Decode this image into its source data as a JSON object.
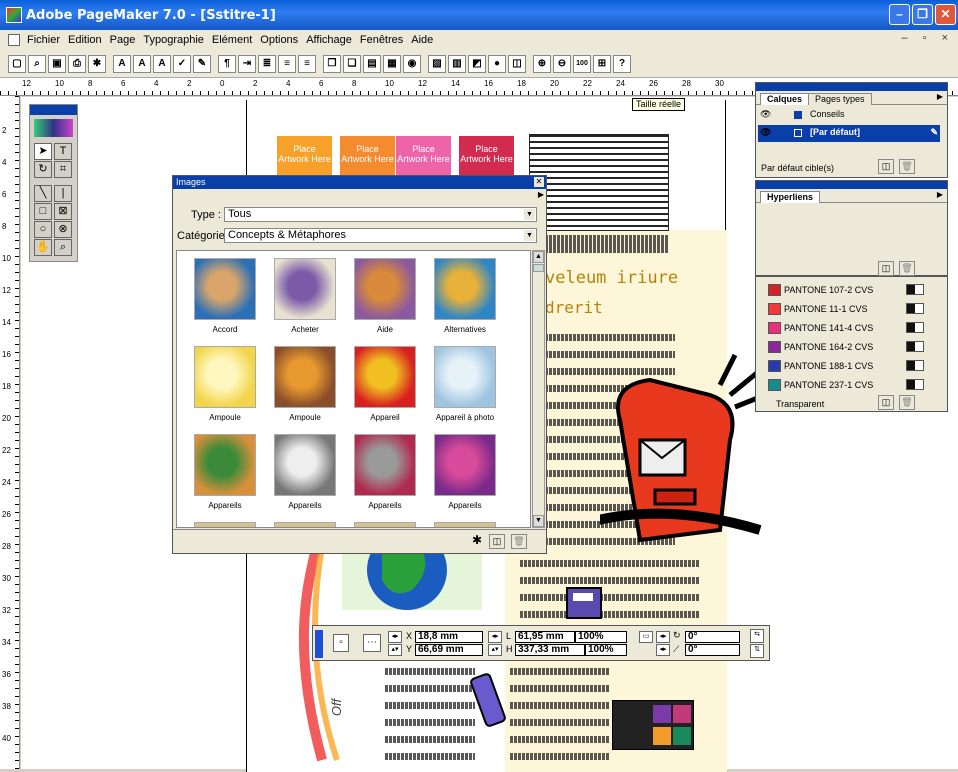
{
  "window": {
    "title": "Adobe PageMaker 7.0 - [Sstitre-1]",
    "min": "–",
    "max": "❐",
    "close": "✕"
  },
  "menu": [
    "Fichier",
    "Edition",
    "Page",
    "Typographie",
    "Elément",
    "Options",
    "Affichage",
    "Fenêtres",
    "Aide"
  ],
  "mdi": "– ▫ ×",
  "toolbar": [
    {
      "name": "new-icon",
      "g": "▢"
    },
    {
      "name": "open-icon",
      "g": "⌕"
    },
    {
      "name": "save-icon",
      "g": "▣"
    },
    {
      "name": "print-icon",
      "g": "⎙"
    },
    {
      "name": "find-icon",
      "g": "✱"
    },
    {
      "name": "font-size-icon",
      "g": "A"
    },
    {
      "name": "font-up-icon",
      "g": "A"
    },
    {
      "name": "font-down-icon",
      "g": "A"
    },
    {
      "name": "spell-icon",
      "g": "✓"
    },
    {
      "name": "edit-icon",
      "g": "✎"
    },
    {
      "name": "paragraph-icon",
      "g": "¶"
    },
    {
      "name": "indent-icon",
      "g": "⇥"
    },
    {
      "name": "bullets-icon",
      "g": "≣"
    },
    {
      "name": "left-align-icon",
      "g": "≡"
    },
    {
      "name": "right-align-icon",
      "g": "≡"
    },
    {
      "name": "copy-icon",
      "g": "❐"
    },
    {
      "name": "paste-icon",
      "g": "❏"
    },
    {
      "name": "frame-icon",
      "g": "▤"
    },
    {
      "name": "grid-icon",
      "g": "▦"
    },
    {
      "name": "color-icon",
      "g": "◉"
    },
    {
      "name": "image-icon",
      "g": "▨"
    },
    {
      "name": "text-frame-icon",
      "g": "▥"
    },
    {
      "name": "pdf-icon",
      "g": "◩"
    },
    {
      "name": "globe-icon",
      "g": "●"
    },
    {
      "name": "layout-icon",
      "g": "◫"
    },
    {
      "name": "zoom-in-icon",
      "g": "⊕"
    },
    {
      "name": "zoom-out-icon",
      "g": "⊖"
    },
    {
      "name": "actual-size-icon",
      "g": "100"
    },
    {
      "name": "fit-page-icon",
      "g": "⊞"
    },
    {
      "name": "help-icon",
      "g": "?"
    }
  ],
  "ruler_top": [
    "12",
    "10",
    "8",
    "6",
    "4",
    "2",
    "0",
    "2",
    "4",
    "6",
    "8",
    "10",
    "12",
    "14",
    "16",
    "18",
    "20",
    "22",
    "24",
    "26",
    "28",
    "30"
  ],
  "ruler_left": [
    "2",
    "4",
    "6",
    "8",
    "10",
    "12",
    "14",
    "16",
    "18",
    "20",
    "22",
    "24",
    "26",
    "28",
    "30",
    "32",
    "34",
    "36",
    "38",
    "40"
  ],
  "tooltip": "Taille réelle",
  "tiles": [
    "Place Artwork Here",
    "Place Artwork Here",
    "Place Artwork Here",
    "Place Artwork Here"
  ],
  "tile_colors": [
    "#f7a12b",
    "#f58b2f",
    "#ee64a8",
    "#d32a50"
  ],
  "page_text": {
    "heading1": "veleum iriure",
    "heading2": "drerit",
    "vertical": "Off"
  },
  "images_panel": {
    "title": "Images",
    "type_label": "Type :",
    "type_value": "Tous",
    "category_label": "Catégorie :",
    "category_value": "Concepts & Métaphores",
    "items": [
      {
        "label": "Accord",
        "c1": "#2a6fb8",
        "c2": "#d9a56b"
      },
      {
        "label": "Acheter",
        "c1": "#e8e2d0",
        "c2": "#7b5aa8"
      },
      {
        "label": "Aide",
        "c1": "#8b5a9e",
        "c2": "#d98a3a"
      },
      {
        "label": "Alternatives",
        "c1": "#2f86c6",
        "c2": "#e8b13a"
      },
      {
        "label": "Ampoule",
        "c1": "#f2d54a",
        "c2": "#fff7c0"
      },
      {
        "label": "Ampoule",
        "c1": "#8a4e2a",
        "c2": "#e89a30"
      },
      {
        "label": "Appareil",
        "c1": "#d82020",
        "c2": "#f0c020"
      },
      {
        "label": "Appareil à photo",
        "c1": "#9fc4e0",
        "c2": "#e6f2f8"
      },
      {
        "label": "Appareils",
        "c1": "#d8903a",
        "c2": "#3a8a3a"
      },
      {
        "label": "Appareils",
        "c1": "#777777",
        "c2": "#eeeeee"
      },
      {
        "label": "Appareils",
        "c1": "#b02a50",
        "c2": "#9a9a9a"
      },
      {
        "label": "Appareils",
        "c1": "#7a2a8a",
        "c2": "#d84a9a"
      }
    ]
  },
  "layers_panel": {
    "tabs": [
      "Calques",
      "Pages types"
    ],
    "layers": [
      "Conseils",
      "[Par défaut]"
    ],
    "footer": "Par défaut cible(s)"
  },
  "hyperlinks_panel": {
    "tab": "Hyperliens"
  },
  "colors_panel": {
    "items": [
      {
        "name": "PANTONE 107-2 CVS",
        "color": "#d2232a"
      },
      {
        "name": "PANTONE 11-1 CVS",
        "color": "#ef3b3b"
      },
      {
        "name": "PANTONE 141-4 CVS",
        "color": "#e8317a"
      },
      {
        "name": "PANTONE 164-2 CVS",
        "color": "#8a2a9a"
      },
      {
        "name": "PANTONE 188-1 CVS",
        "color": "#2a3aa8"
      },
      {
        "name": "PANTONE 237-1 CVS",
        "color": "#1a8a8a"
      }
    ],
    "footer": "Transparent"
  },
  "control_palette": {
    "x_label": "X",
    "x": "18,8 mm",
    "y_label": "Y",
    "y": "66,69 mm",
    "w_label": "L",
    "w": "61,95 mm",
    "w_pct": "100%",
    "h_label": "H",
    "h": "337,33 mm",
    "h_pct": "100%",
    "rot": "0°",
    "skew": "0°"
  }
}
